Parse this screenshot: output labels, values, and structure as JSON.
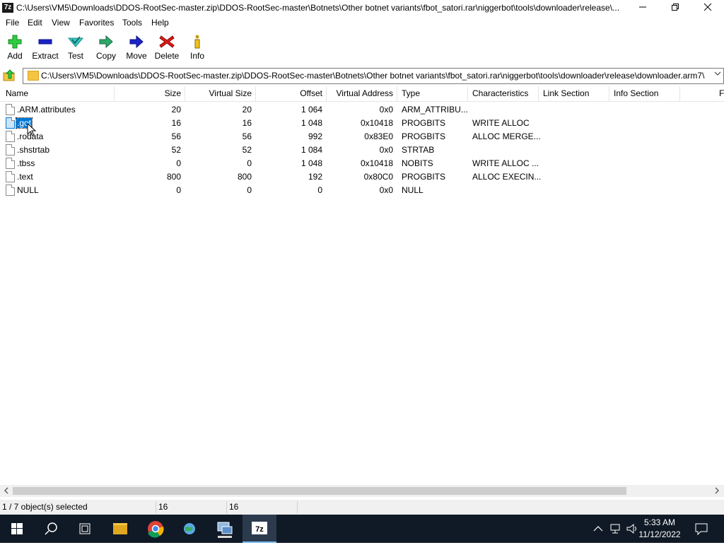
{
  "window": {
    "title": "C:\\Users\\VM5\\Downloads\\DDOS-RootSec-master.zip\\DDOS-RootSec-master\\Botnets\\Other botnet variants\\fbot_satori.rar\\niggerbot\\tools\\downloader\\release\\...",
    "app_icon_text": "7z"
  },
  "menu": [
    "File",
    "Edit",
    "View",
    "Favorites",
    "Tools",
    "Help"
  ],
  "toolbar": {
    "add": "Add",
    "extract": "Extract",
    "test": "Test",
    "copy": "Copy",
    "move": "Move",
    "delete": "Delete",
    "info": "Info"
  },
  "address": {
    "path": "C:\\Users\\VM5\\Downloads\\DDOS-RootSec-master.zip\\DDOS-RootSec-master\\Botnets\\Other botnet variants\\fbot_satori.rar\\niggerbot\\tools\\downloader\\release\\downloader.arm7\\"
  },
  "columns": {
    "name": "Name",
    "size": "Size",
    "virtual_size": "Virtual Size",
    "offset": "Offset",
    "virtual_address": "Virtual Address",
    "type": "Type",
    "characteristics": "Characteristics",
    "link_section": "Link Section",
    "info_section": "Info Section",
    "extra": "F"
  },
  "rows": [
    {
      "name": ".ARM.attributes",
      "size": "20",
      "vsize": "20",
      "offset": "1 064",
      "vaddr": "0x0",
      "type": "ARM_ATTRIBU...",
      "chars": ""
    },
    {
      "name": ".got",
      "size": "16",
      "vsize": "16",
      "offset": "1 048",
      "vaddr": "0x10418",
      "type": "PROGBITS",
      "chars": "WRITE ALLOC"
    },
    {
      "name": ".rodata",
      "size": "56",
      "vsize": "56",
      "offset": "992",
      "vaddr": "0x83E0",
      "type": "PROGBITS",
      "chars": "ALLOC MERGE..."
    },
    {
      "name": ".shstrtab",
      "size": "52",
      "vsize": "52",
      "offset": "1 084",
      "vaddr": "0x0",
      "type": "STRTAB",
      "chars": ""
    },
    {
      "name": ".tbss",
      "size": "0",
      "vsize": "0",
      "offset": "1 048",
      "vaddr": "0x10418",
      "type": "NOBITS",
      "chars": "WRITE ALLOC ..."
    },
    {
      "name": ".text",
      "size": "800",
      "vsize": "800",
      "offset": "192",
      "vaddr": "0x80C0",
      "type": "PROGBITS",
      "chars": "ALLOC EXECIN..."
    },
    {
      "name": "NULL",
      "size": "0",
      "vsize": "0",
      "offset": "0",
      "vaddr": "0x0",
      "type": "NULL",
      "chars": ""
    }
  ],
  "status": {
    "selected": "1 / 7 object(s) selected",
    "size": "16",
    "vsize": "16"
  },
  "taskbar": {
    "time": "5:33 AM",
    "date": "11/12/2022"
  }
}
